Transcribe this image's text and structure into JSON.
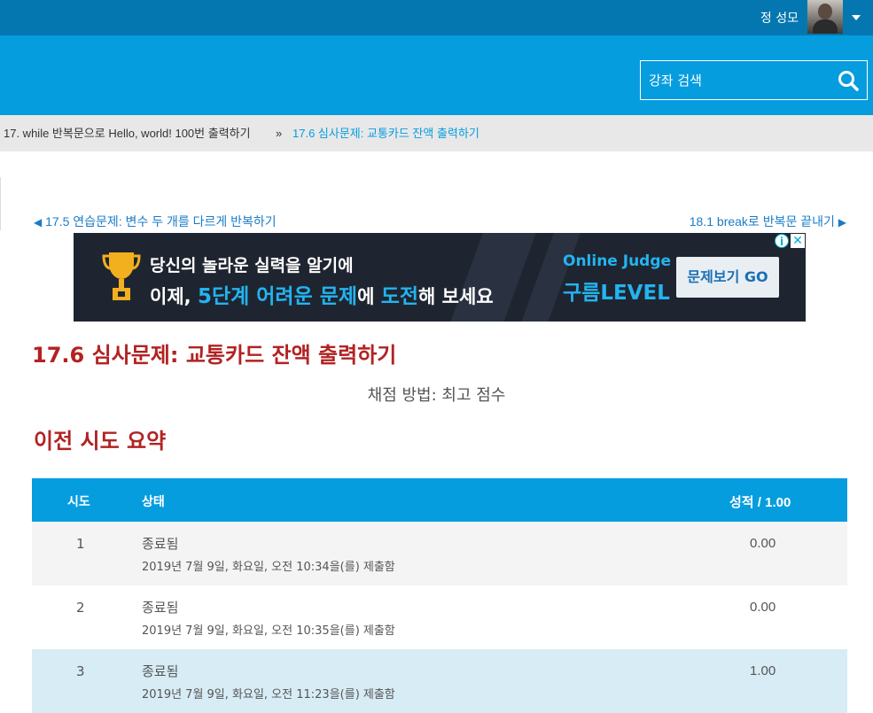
{
  "topbar": {
    "user_name": "정 성모"
  },
  "search": {
    "placeholder": "강좌 검색"
  },
  "breadcrumb": {
    "items": [
      "17. while 반복문으로 Hello, world! 100번 출력하기",
      "17.6 심사문제: 교통카드 잔액 출력하기"
    ],
    "separator": "»"
  },
  "nav": {
    "prev_label": "17.5 연습문제: 변수 두 개를 다르게 반복하기",
    "next_label": "18.1 break로 반복문 끝내기",
    "prev_arrow": "◀",
    "next_arrow": "▶"
  },
  "ad": {
    "line1": "당신의 놀라운 실력을 알기에",
    "line2_pre": "이제, ",
    "line2_hl1": "5단계 어려운 문제",
    "line2_mid": "에 ",
    "line2_hl2": "도전",
    "line2_post": "해 보세요",
    "brand_line1": "Online Judge",
    "brand_line2": "구름LEVEL",
    "button": "문제보기 GO",
    "info": "i",
    "close": "✕",
    "colors": {
      "background": "#1f2530",
      "accent": "#23b4f0"
    }
  },
  "page": {
    "title": "17.6 심사문제: 교통카드 잔액 출력하기",
    "grading_method": "채점 방법: 최고 점수",
    "section_title": "이전 시도 요약"
  },
  "summary_table": {
    "headers": {
      "attempt": "시도",
      "state": "상태",
      "grade": "성적 / 1.00"
    },
    "rows": [
      {
        "attempt": "1",
        "state": "종료됨",
        "submitted": "2019년 7월 9일, 화요일, 오전 10:34을(를) 제출함",
        "grade": "0.00"
      },
      {
        "attempt": "2",
        "state": "종료됨",
        "submitted": "2019년 7월 9일, 화요일, 오전 10:35을(를) 제출함",
        "grade": "0.00"
      },
      {
        "attempt": "3",
        "state": "종료됨",
        "submitted": "2019년 7월 9일, 화요일, 오전 11:23을(를) 제출함",
        "grade": "1.00"
      }
    ]
  },
  "colors": {
    "topbar": "#0477b0",
    "header": "#069ddf",
    "title_red": "#b22222",
    "link_blue": "#1a7cc8",
    "highlight_row": "#d7ecf5"
  }
}
